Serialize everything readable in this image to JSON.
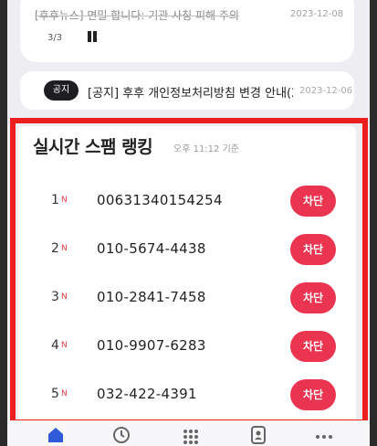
{
  "news": {
    "text": "[후후뉴스] 면밀 합니다: 기관 사칭 피해 주의",
    "date": "2023-12-08",
    "page_indicator": "3/3"
  },
  "notice": {
    "badge": "공지",
    "title": "[공지] 후후 개인정보처리방침 변경 안내(2…",
    "date": "2023-12-06"
  },
  "spam_ranking": {
    "title": "실시간 스팸 랭킹",
    "updated": "오후 11:12 기준",
    "items": [
      {
        "rank": "1",
        "new": "N",
        "phone": "00631340154254",
        "action": "차단"
      },
      {
        "rank": "2",
        "new": "N",
        "phone": "010-5674-4438",
        "action": "차단"
      },
      {
        "rank": "3",
        "new": "N",
        "phone": "010-2841-7458",
        "action": "차단"
      },
      {
        "rank": "4",
        "new": "N",
        "phone": "010-9907-6283",
        "action": "차단"
      },
      {
        "rank": "5",
        "new": "N",
        "phone": "032-422-4391",
        "action": "차단"
      }
    ]
  },
  "bottom_nav": {
    "items": [
      {
        "icon": "home-icon",
        "active": true
      },
      {
        "icon": "clock-icon",
        "active": false
      },
      {
        "icon": "dialpad-icon",
        "active": false
      },
      {
        "icon": "contact-icon",
        "active": false
      },
      {
        "icon": "more-icon",
        "active": false
      }
    ]
  },
  "colors": {
    "accent": "#ea3450",
    "highlight_frame": "#ec1e1e",
    "active_nav": "#2f5bd8"
  }
}
